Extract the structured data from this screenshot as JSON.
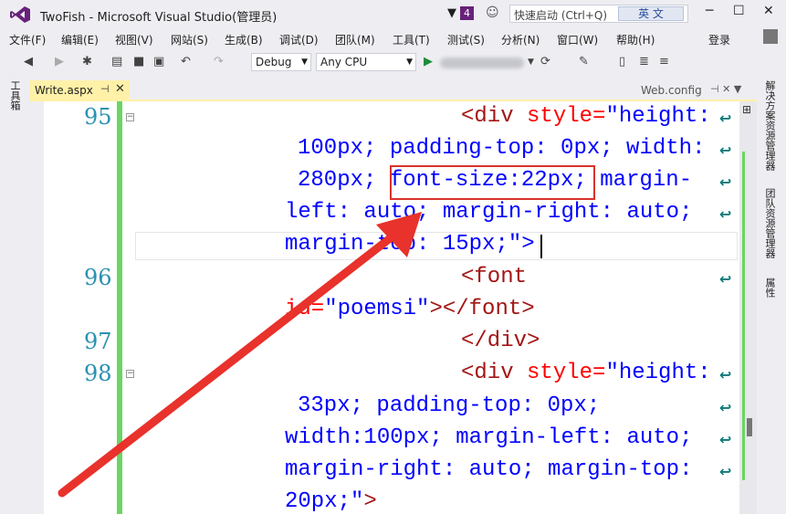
{
  "window": {
    "title": "TwoFish - Microsoft Visual Studio(管理员)",
    "notification_count": "4",
    "quick_launch_placeholder": "快速启动 (Ctrl+Q)",
    "ime_label": "英 文"
  },
  "menu": {
    "items": [
      "文件(F)",
      "编辑(E)",
      "视图(V)",
      "网站(S)",
      "生成(B)",
      "调试(D)",
      "团队(M)",
      "工具(T)",
      "测试(S)",
      "分析(N)",
      "窗口(W)",
      "帮助(H)"
    ],
    "login": "登录"
  },
  "toolbar": {
    "config": "Debug",
    "platform": "Any CPU"
  },
  "side_tabs": {
    "toolbox": "工具箱",
    "solution_explorer": "解决方案资源管理器",
    "team_explorer": "团队资源管理器",
    "properties": "属性"
  },
  "tabs": {
    "active": "Write.aspx",
    "right": "Web.config"
  },
  "editor": {
    "line_numbers": [
      "95",
      "96",
      "97",
      "98"
    ],
    "lines": {
      "l1_tag": "<div",
      "l1_attr": " style=",
      "l1_val": "\"height:",
      "l2": "100px; padding-top: 0px; width:",
      "l3a": "280px; ",
      "l3b": "font-size:22px;",
      "l3c": " margin-",
      "l4": "left: auto; margin-right: auto;",
      "l5_val": "margin-top: 15px;\"",
      "l5_tag": ">",
      "l6_tag": "<font",
      "l7_attr": "id=",
      "l7_val": "\"poemsi\"",
      "l7_tag": "></font>",
      "l8_tag": "</div>",
      "l9_tag": "<div",
      "l9_attr": " style=",
      "l9_val": "\"height:",
      "l10": "33px; padding-top: 0px;",
      "l11": "width:100px; margin-left: auto;",
      "l12": "margin-right: auto; margin-top:",
      "l13_val": "20px;\"",
      "l13_tag": ">"
    }
  }
}
